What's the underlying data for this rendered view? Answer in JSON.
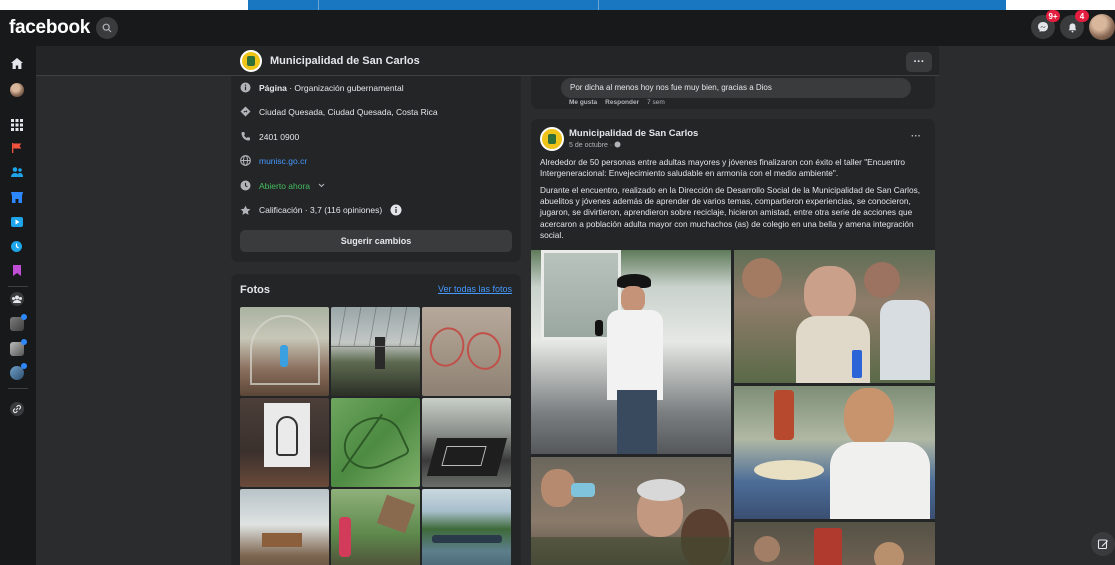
{
  "brand": {
    "logo_text": "facebook"
  },
  "topbar": {
    "messenger_badge": "9+",
    "notifications_badge": "4"
  },
  "page": {
    "name": "Municipalidad de San Carlos",
    "more_label": "···"
  },
  "info": {
    "category_bold": "Página",
    "category_rest": " · Organización gubernamental",
    "address": "Ciudad Quesada, Ciudad Quesada, Costa Rica",
    "phone": "2401 0900",
    "website": "munisc.go.cr",
    "hours": "Abierto ahora",
    "rating": "Calificación · 3,7 (116 opiniones)",
    "suggest_button": "Sugerir cambios"
  },
  "photos": {
    "title": "Fotos",
    "see_all": "Ver todas las fotos"
  },
  "comment": {
    "text": "Por dicha al menos hoy nos fue muy bien, gracias a Dios",
    "like": "Me gusta",
    "reply": "Responder",
    "time": "7 sem"
  },
  "post": {
    "author": "Municipalidad de San Carlos",
    "date": "5 de octubre · ",
    "more_label": "···",
    "paragraph1": "Alrededor de 50 personas entre adultas mayores y jóvenes finalizaron con éxito el taller \"Encuentro Intergeneracional: Envejecimiento saludable en armonía con el medio ambiente\".",
    "paragraph2": "Durante el encuentro, realizado en la Dirección de Desarrollo Social de la Municipalidad de San Carlos, abuelitos y jóvenes además de aprender de varios temas, compartieron experiencias, se conocieron, jugaron, se divirtieron, aprendieron sobre reciclaje, hicieron amistad, entre otra serie de acciones que acercaron a población adulta mayor con muchachos (as) de colegio en una bella y amena integración social."
  },
  "colors": {
    "background": "#18191a",
    "card": "#242526",
    "link": "#4599ff",
    "open_green": "#45bd62",
    "badge_red": "#e41e3f"
  }
}
